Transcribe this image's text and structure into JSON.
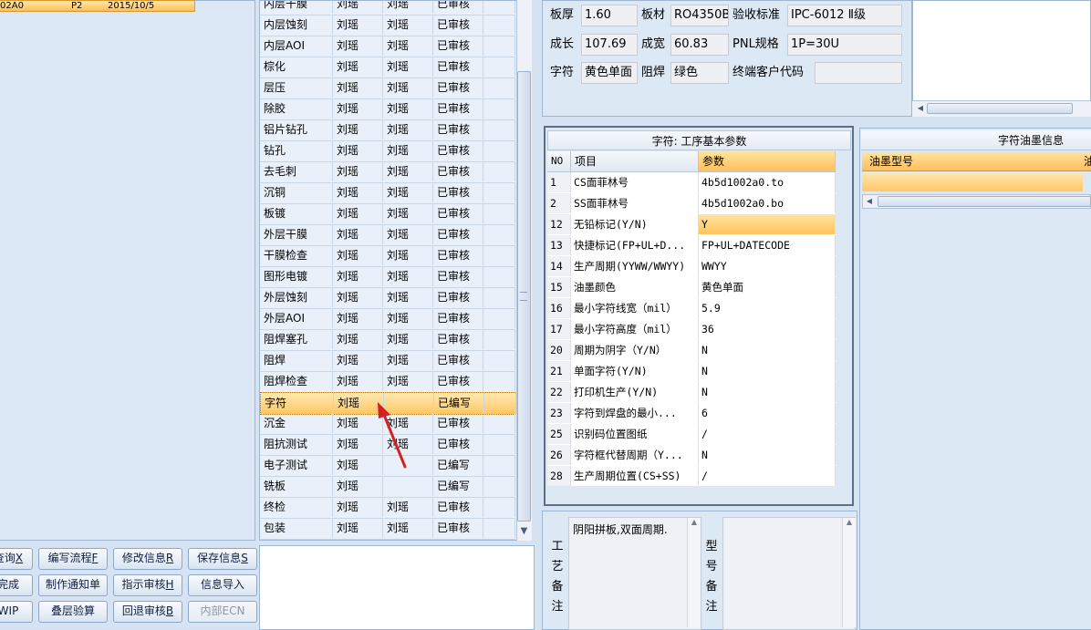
{
  "left_list": {
    "row": {
      "code": "02A0",
      "type": "P2",
      "date": "2015/10/5"
    }
  },
  "buttons": [
    {
      "label": "查询",
      "key": "X",
      "disabled": false
    },
    {
      "label": "编写流程",
      "key": "F",
      "disabled": false
    },
    {
      "label": "修改信息",
      "key": "R",
      "disabled": false
    },
    {
      "label": "保存信息",
      "key": "S",
      "disabled": false
    },
    {
      "label": "完成",
      "key": "",
      "disabled": false
    },
    {
      "label": "制作通知单",
      "key": "",
      "disabled": false
    },
    {
      "label": "指示审核",
      "key": "H",
      "disabled": false
    },
    {
      "label": "信息导入",
      "key": "",
      "disabled": false
    },
    {
      "label": "WIP",
      "key": "",
      "disabled": false
    },
    {
      "label": "叠层验算",
      "key": "",
      "disabled": false
    },
    {
      "label": "回退审核",
      "key": "B",
      "disabled": false
    },
    {
      "label": "内部ECN",
      "key": "",
      "disabled": true
    }
  ],
  "process_grid": {
    "rows": [
      {
        "step": "内层干膜",
        "c1": "刘瑶",
        "c2": "刘瑶",
        "status": "已审核"
      },
      {
        "step": "内层蚀刻",
        "c1": "刘瑶",
        "c2": "刘瑶",
        "status": "已审核"
      },
      {
        "step": "内层AOI",
        "c1": "刘瑶",
        "c2": "刘瑶",
        "status": "已审核"
      },
      {
        "step": "棕化",
        "c1": "刘瑶",
        "c2": "刘瑶",
        "status": "已审核"
      },
      {
        "step": "层压",
        "c1": "刘瑶",
        "c2": "刘瑶",
        "status": "已审核"
      },
      {
        "step": "除胶",
        "c1": "刘瑶",
        "c2": "刘瑶",
        "status": "已审核"
      },
      {
        "step": "铝片钻孔",
        "c1": "刘瑶",
        "c2": "刘瑶",
        "status": "已审核"
      },
      {
        "step": "钻孔",
        "c1": "刘瑶",
        "c2": "刘瑶",
        "status": "已审核"
      },
      {
        "step": "去毛刺",
        "c1": "刘瑶",
        "c2": "刘瑶",
        "status": "已审核"
      },
      {
        "step": "沉铜",
        "c1": "刘瑶",
        "c2": "刘瑶",
        "status": "已审核"
      },
      {
        "step": "板镀",
        "c1": "刘瑶",
        "c2": "刘瑶",
        "status": "已审核"
      },
      {
        "step": "外层干膜",
        "c1": "刘瑶",
        "c2": "刘瑶",
        "status": "已审核"
      },
      {
        "step": "干膜检查",
        "c1": "刘瑶",
        "c2": "刘瑶",
        "status": "已审核"
      },
      {
        "step": "图形电镀",
        "c1": "刘瑶",
        "c2": "刘瑶",
        "status": "已审核"
      },
      {
        "step": "外层蚀刻",
        "c1": "刘瑶",
        "c2": "刘瑶",
        "status": "已审核"
      },
      {
        "step": "外层AOI",
        "c1": "刘瑶",
        "c2": "刘瑶",
        "status": "已审核"
      },
      {
        "step": "阻焊塞孔",
        "c1": "刘瑶",
        "c2": "刘瑶",
        "status": "已审核"
      },
      {
        "step": "阻焊",
        "c1": "刘瑶",
        "c2": "刘瑶",
        "status": "已审核"
      },
      {
        "step": "阻焊检查",
        "c1": "刘瑶",
        "c2": "刘瑶",
        "status": "已审核"
      },
      {
        "step": "字符",
        "c1": "刘瑶",
        "c2": "",
        "status": "已编写",
        "selected": true
      },
      {
        "step": "沉金",
        "c1": "刘瑶",
        "c2": "刘瑶",
        "status": "已审核"
      },
      {
        "step": "阻抗测试",
        "c1": "刘瑶",
        "c2": "刘瑶",
        "status": "已审核"
      },
      {
        "step": "电子测试",
        "c1": "刘瑶",
        "c2": "",
        "status": "已编写"
      },
      {
        "step": "铣板",
        "c1": "刘瑶",
        "c2": "",
        "status": "已编写"
      },
      {
        "step": "终检",
        "c1": "刘瑶",
        "c2": "刘瑶",
        "status": "已审核"
      },
      {
        "step": "包装",
        "c1": "刘瑶",
        "c2": "刘瑶",
        "status": "已审核"
      }
    ]
  },
  "info": {
    "thickness_label": "板厚",
    "thickness": "1.60",
    "material_label": "板材",
    "material": "RO4350B",
    "standard_label": "验收标准",
    "standard": "IPC-6012 Ⅱ级",
    "length_label": "成长",
    "length": "107.69",
    "width_label": "成宽",
    "width": "60.83",
    "pnl_label": "PNL规格",
    "pnl": "1P=30U",
    "char_label": "字符",
    "char": "黄色单面",
    "mask_label": "阻焊",
    "mask": "绿色",
    "customer_label": "终端客户代码",
    "customer": ""
  },
  "params": {
    "title": "字符: 工序基本参数",
    "col_no": "NO",
    "col_item": "项目",
    "col_value": "参数",
    "rows": [
      {
        "no": "1",
        "item": "CS面菲林号",
        "value": "4b5d1002a0.to"
      },
      {
        "no": "2",
        "item": "SS面菲林号",
        "value": "4b5d1002a0.bo"
      },
      {
        "no": "12",
        "item": "无铅标记(Y/N)",
        "value": "Y",
        "highlight": true
      },
      {
        "no": "13",
        "item": "快捷标记(FP+UL+D...",
        "value": "FP+UL+DATECODE"
      },
      {
        "no": "14",
        "item": "生产周期(YYWW/WWYY)",
        "value": "WWYY"
      },
      {
        "no": "15",
        "item": "油墨颜色",
        "value": "黄色单面"
      },
      {
        "no": "16",
        "item": "最小字符线宽（mil）",
        "value": "5.9"
      },
      {
        "no": "17",
        "item": "最小字符高度（mil）",
        "value": "36"
      },
      {
        "no": "20",
        "item": "周期为阴字（Y/N）",
        "value": "N"
      },
      {
        "no": "21",
        "item": "单面字符(Y/N)",
        "value": "N"
      },
      {
        "no": "22",
        "item": "打印机生产(Y/N)",
        "value": "N"
      },
      {
        "no": "23",
        "item": "字符到焊盘的最小...",
        "value": "6"
      },
      {
        "no": "25",
        "item": "识别码位置图纸",
        "value": "/"
      },
      {
        "no": "26",
        "item": "字符框代替周期（Y...",
        "value": "N"
      },
      {
        "no": "28",
        "item": "生产周期位置(CS+SS)",
        "value": "/"
      }
    ]
  },
  "ink": {
    "title": "字符油墨信息",
    "col_type": "油墨型号",
    "col_extra": "油"
  },
  "remarks": {
    "process_label": "工艺备注",
    "process_text": "阴阳拼板,双面周期.",
    "model_label": "型号备注",
    "model_text": ""
  },
  "colors": {
    "selected_row": "#ffc766",
    "panel_bg": "#dde8f5",
    "arrow": "#d42020"
  }
}
